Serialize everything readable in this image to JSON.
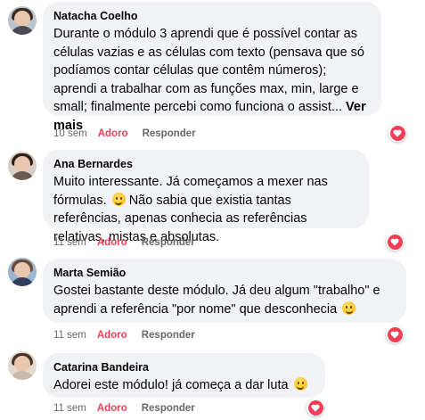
{
  "comments": [
    {
      "author": "Natacha Coelho",
      "text": "Durante o módulo 3 aprendi que é possível contar as células vazias e as células com texto (pensava que só podíamos contar células que contêm números); aprendi a trabalhar com as funções max, min, large e small; finalmente percebi como funciona o assist... ",
      "see_more": "Ver mais",
      "time": "10 sem",
      "reaction_label": "Adoro",
      "reply_label": "Responder",
      "reaction_icon": "heart-icon",
      "avatar_colors": {
        "hair": "#3b2a20",
        "bg": "#b9c4cf",
        "body": "#4a4a52"
      }
    },
    {
      "author": "Ana Bernardes",
      "text_before_emoji": "Muito interessante. Já começamos a mexer nas fórmulas. ",
      "text_after_emoji": " Não sabia que existia tantas referências, apenas conhecia as referências relativas, mistas e absolutas.",
      "time": "11 sem",
      "reaction_label": "Adoro",
      "reply_label": "Responder",
      "reaction_icon": "heart-icon",
      "avatar_colors": {
        "hair": "#2b1d17",
        "bg": "#d7cfc6",
        "body": "#6a5a52"
      }
    },
    {
      "author": "Marta Semião",
      "text": "Gostei bastante deste módulo. Já deu algum \"trabalho\" e aprendi a referência \"por nome\" que desconhecia ",
      "time": "11 sem",
      "reaction_label": "Adoro",
      "reply_label": "Responder",
      "reaction_icon": "heart-icon",
      "avatar_colors": {
        "hair": "#6b4a36",
        "bg": "#9cb6cf",
        "body": "#2f3f5c"
      }
    },
    {
      "author": "Catarina Bandeira",
      "text": "Adorei este módulo! já começa a dar luta ",
      "time": "11 sem",
      "reaction_label": "Adoro",
      "reply_label": "Responder",
      "reaction_icon": "heart-icon",
      "avatar_colors": {
        "hair": "#4a3325",
        "bg": "#e3d9cf",
        "body": "#c8b9aa"
      }
    }
  ]
}
